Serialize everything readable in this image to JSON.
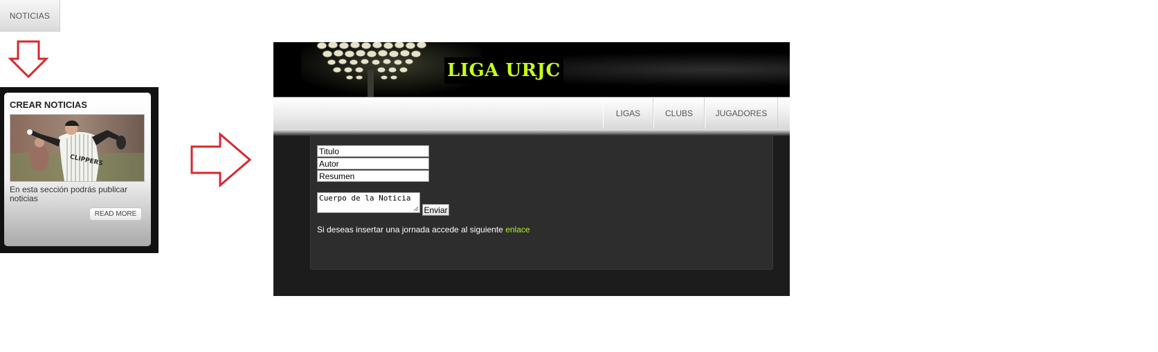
{
  "top_button": {
    "label": "NOTICIAS"
  },
  "card": {
    "title": "CREAR NOTICIAS",
    "text": "En esta sección podrás publicar noticias",
    "read_more": "READ MORE"
  },
  "site": {
    "banner_title": "LIGA URJC",
    "nav": [
      "LIGAS",
      "CLUBS",
      "JUGADORES"
    ],
    "form": {
      "titulo": "Titulo",
      "autor": "Autor",
      "resumen": "Resumen",
      "cuerpo": "Cuerpo de la Noticia",
      "enviar": "Enviar"
    },
    "help_text": "Si deseas insertar una jornada accede al siguiente",
    "help_link": "enlace"
  },
  "colors": {
    "arrow": "#d9262b",
    "accent": "#c6ff1a",
    "link": "#b4f41c"
  }
}
